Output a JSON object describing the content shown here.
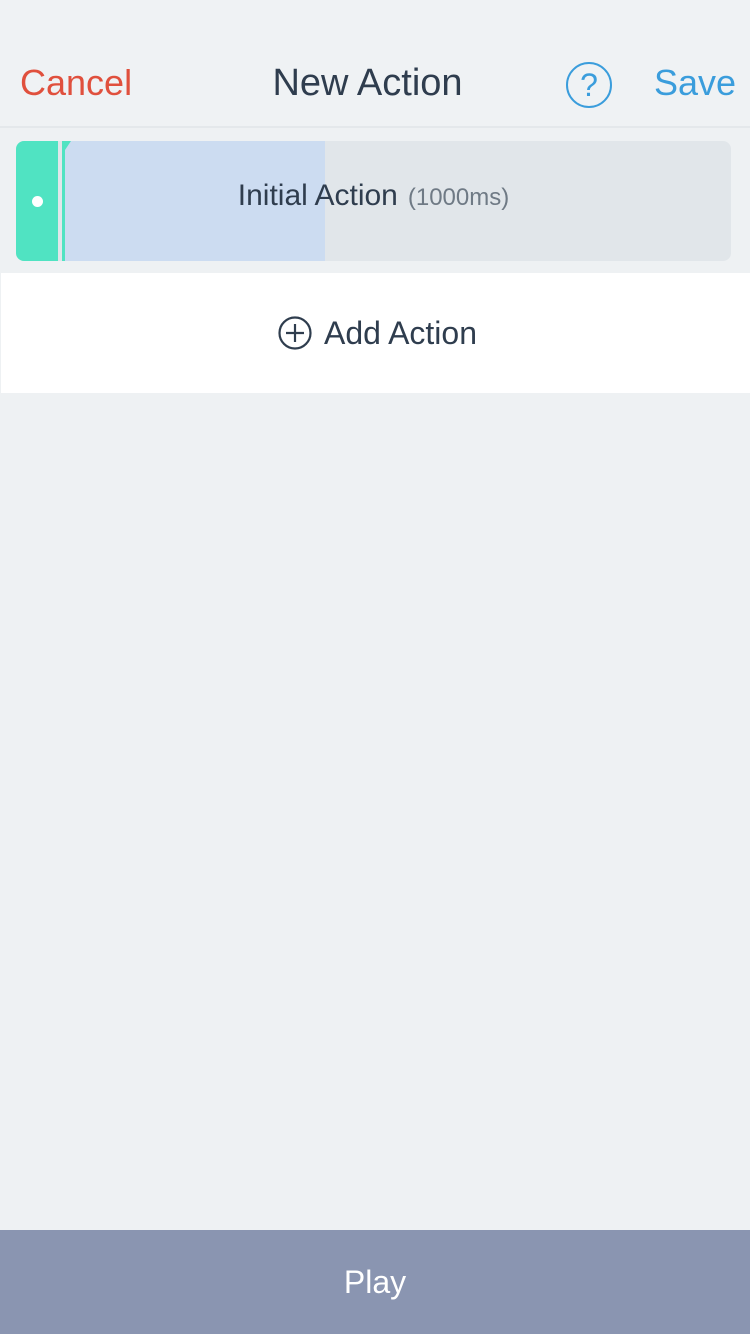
{
  "navbar": {
    "cancel_label": "Cancel",
    "title": "New Action",
    "help_glyph": "?",
    "help_icon": "question-circle-icon",
    "save_label": "Save"
  },
  "actions": [
    {
      "label": "Initial Action",
      "duration": "(1000ms)",
      "playback_progress": 0.39,
      "handle_color": "#50e3c2",
      "progress_color": "#ccdcf1"
    }
  ],
  "add_action": {
    "label": "Add Action",
    "icon": "plus-circle-icon"
  },
  "play": {
    "label": "Play"
  },
  "colors": {
    "cancel": "#e0503d",
    "accent": "#3a9ddc",
    "play_bar": "#8a95b1",
    "background": "#eef1f3"
  }
}
